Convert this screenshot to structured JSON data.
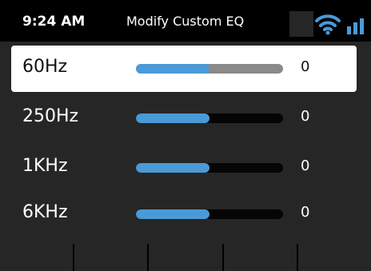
{
  "status_bar": {
    "time": "9:24 AM",
    "title": "Modify Custom EQ",
    "accent_color": "#4a9ad8",
    "icons": [
      "wifi-icon",
      "signal-bars-icon"
    ]
  },
  "eq": {
    "bands": [
      {
        "label": "60Hz",
        "value": "0",
        "level": 0.5,
        "selected": true
      },
      {
        "label": "250Hz",
        "value": "0",
        "level": 0.5,
        "selected": false
      },
      {
        "label": "1KHz",
        "value": "0",
        "level": 0.5,
        "selected": false
      },
      {
        "label": "6KHz",
        "value": "0",
        "level": 0.5,
        "selected": false
      }
    ]
  },
  "softkeys": {
    "count": 5
  }
}
